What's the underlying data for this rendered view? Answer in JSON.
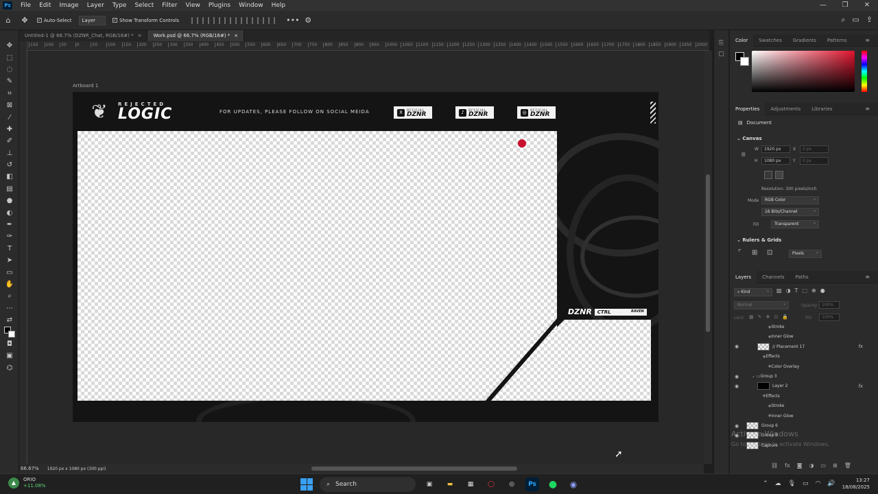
{
  "app": {
    "logo": "Ps",
    "menu": [
      "File",
      "Edit",
      "Image",
      "Layer",
      "Type",
      "Select",
      "Filter",
      "View",
      "Plugins",
      "Window",
      "Help"
    ],
    "window_controls": [
      "—",
      "❐",
      "✕"
    ]
  },
  "options_bar": {
    "auto_select_label": "Auto-Select",
    "auto_select_target": "Layer",
    "show_transform_label": "Show Transform Controls",
    "more": "•••"
  },
  "tabs": [
    {
      "label": "Untitled-1 @ 66.7% (DZNR_Chat, RGB/16#) *",
      "close": "×"
    },
    {
      "label": "Work.psd @ 66.7% (RGB/16#) *",
      "close": "×"
    }
  ],
  "ruler_ticks": [
    "150",
    "100",
    "50",
    "0",
    "50",
    "100",
    "150",
    "200",
    "250",
    "300",
    "350",
    "400",
    "450",
    "500",
    "550",
    "600",
    "650",
    "700",
    "750",
    "800",
    "850",
    "900",
    "950",
    "1000",
    "1050",
    "1100",
    "1150",
    "1200",
    "1250",
    "1300",
    "1350",
    "1400",
    "1450",
    "1500",
    "1550",
    "1600",
    "1650",
    "1700",
    "1750",
    "1800",
    "1850",
    "1900",
    "1950",
    "2000"
  ],
  "artboard": {
    "label": "Artboard 1",
    "brand_small": "REJECTED",
    "brand_large": "LOGIC",
    "follow_text": "FOR UPDATES, PLEASE FOLLOW ON SOCIAL MEIDA",
    "socials": [
      {
        "icon": "X",
        "official": "OFFICIAL",
        "name": "DZNR"
      },
      {
        "icon": "♪",
        "official": "OFFICIAL",
        "name": "DZNR"
      },
      {
        "icon": "◎",
        "official": "OFFICIAL",
        "name": "DZNR"
      }
    ],
    "bottom_brand": "DZNR",
    "ctrl_text": "CTRL",
    "raven_text": "RAVEN",
    "accent_color": "#c8102e"
  },
  "color_panel": {
    "tabs": [
      "Color",
      "Swatches",
      "Gradients",
      "Patterns"
    ]
  },
  "properties": {
    "tabs": [
      "Properties",
      "Adjustments",
      "Libraries"
    ],
    "doc_label": "Document",
    "canvas_title": "Canvas",
    "w_label": "W",
    "w_value": "1920 px",
    "h_label": "H",
    "h_value": "1080 px",
    "x_label": "X",
    "x_placeholder": "0 px",
    "y_label": "Y",
    "y_placeholder": "0 px",
    "resolution": "Resolution: 300 pixels/inch",
    "mode_label": "Mode",
    "mode_value": "RGB Color",
    "bits_value": "16 Bits/Channel",
    "fill_label": "Fill",
    "fill_value": "Transparent",
    "rulers_title": "Rulers & Grids",
    "units_value": "Pixels"
  },
  "layers_panel": {
    "tabs": [
      "Layers",
      "Channels",
      "Paths"
    ],
    "kind": "Kind",
    "blend": "Normal",
    "opacity_label": "Opacity:",
    "opacity_value": "100%",
    "lock_label": "Lock:",
    "fill_label": "Fill:",
    "fill_value": "100%",
    "layers": [
      {
        "name": "Stroke",
        "indent": 4,
        "eye": false,
        "thumb": false,
        "fx": false
      },
      {
        "name": "Inner Glow",
        "indent": 4,
        "eye": false,
        "thumb": false,
        "fx": false
      },
      {
        "name": "// Placement 17",
        "indent": 2,
        "eye": true,
        "thumb": true,
        "fx": true
      },
      {
        "name": "Effects",
        "indent": 3,
        "eye": false,
        "thumb": false,
        "fx": false
      },
      {
        "name": "Color Overlay",
        "indent": 4,
        "eye": false,
        "thumb": false,
        "fx": false
      },
      {
        "name": "Group 3",
        "indent": 1,
        "eye": true,
        "thumb": false,
        "fx": false,
        "folder": true
      },
      {
        "name": "Layer 2",
        "indent": 2,
        "eye": true,
        "thumb": true,
        "fx": true,
        "dark": true
      },
      {
        "name": "Effects",
        "indent": 3,
        "eye": false,
        "thumb": false,
        "fx": false
      },
      {
        "name": "Stroke",
        "indent": 4,
        "eye": false,
        "thumb": false,
        "fx": false
      },
      {
        "name": "Inner Glow",
        "indent": 4,
        "eye": false,
        "thumb": false,
        "fx": false
      },
      {
        "name": "Group 6",
        "indent": 0,
        "eye": true,
        "thumb": true,
        "fx": false
      },
      {
        "name": "Group 8",
        "indent": 0,
        "eye": true,
        "thumb": true,
        "fx": false
      },
      {
        "name": "Capture",
        "indent": 0,
        "eye": false,
        "thumb": true,
        "fx": false
      }
    ]
  },
  "status": {
    "zoom": "66.67%",
    "doc_info": "1920 px x 1080 px (300 ppi)"
  },
  "watermark": {
    "line1": "Activate Windows",
    "line2": "Go to Settings to activate Windows."
  },
  "taskbar": {
    "ticker": "ORIO",
    "ticker_change": "+11.08%",
    "search_placeholder": "Search",
    "ps_app": "Ps",
    "time": "13:27",
    "date": "18/08/2025"
  }
}
